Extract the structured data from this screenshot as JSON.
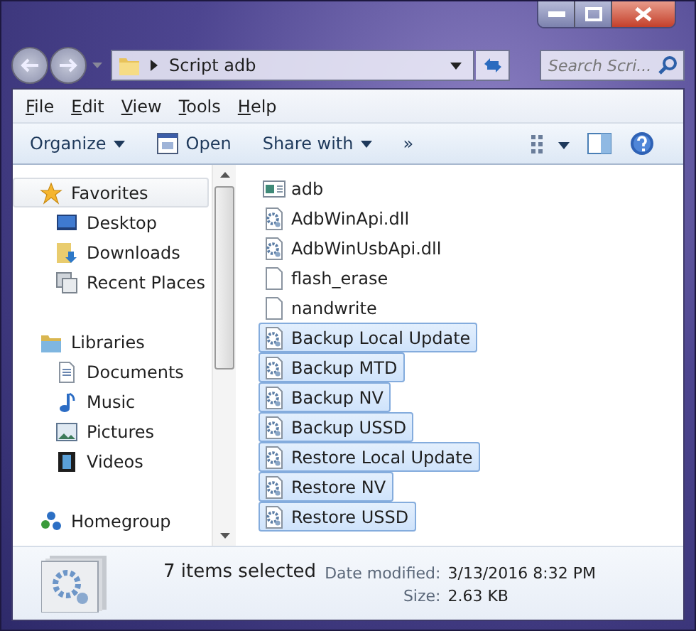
{
  "address": {
    "path": "Script adb"
  },
  "search": {
    "placeholder": "Search Scri..."
  },
  "menu": [
    "File",
    "Edit",
    "View",
    "Tools",
    "Help"
  ],
  "toolbar": [
    {
      "kind": "dropdown",
      "label": "Organize"
    },
    {
      "kind": "open",
      "label": "Open"
    },
    {
      "kind": "dropdown",
      "label": "Share with"
    },
    {
      "kind": "more",
      "label": "»"
    }
  ],
  "sidebar": {
    "groups": [
      {
        "label": "Favorites",
        "selected": true,
        "children": [
          {
            "label": "Desktop",
            "selected": false
          },
          {
            "label": "Downloads",
            "selected": false
          },
          {
            "label": "Recent Places",
            "selected": false
          }
        ]
      },
      {
        "label": "Libraries",
        "selected": false,
        "children": [
          {
            "label": "Documents",
            "selected": false
          },
          {
            "label": "Music",
            "selected": false
          },
          {
            "label": "Pictures",
            "selected": false
          },
          {
            "label": "Videos",
            "selected": false
          }
        ]
      },
      {
        "label": "Homegroup",
        "selected": false
      }
    ]
  },
  "files": [
    {
      "name": "adb",
      "kind": "application",
      "selected": false
    },
    {
      "name": "AdbWinApi.dll",
      "kind": "dll",
      "selected": false
    },
    {
      "name": "AdbWinUsbApi.dll",
      "kind": "dll",
      "selected": false
    },
    {
      "name": "flash_erase",
      "kind": "file",
      "selected": false
    },
    {
      "name": "nandwrite",
      "kind": "file",
      "selected": false
    },
    {
      "name": "Backup Local Update",
      "kind": "batch",
      "selected": true
    },
    {
      "name": "Backup MTD",
      "kind": "batch",
      "selected": true
    },
    {
      "name": "Backup NV",
      "kind": "batch",
      "selected": true
    },
    {
      "name": "Backup USSD",
      "kind": "batch",
      "selected": true
    },
    {
      "name": "Restore Local Update",
      "kind": "batch",
      "selected": true
    },
    {
      "name": "Restore NV",
      "kind": "batch",
      "selected": true
    },
    {
      "name": "Restore USSD",
      "kind": "batch",
      "selected": true
    }
  ],
  "details": {
    "summary": "7 items selected",
    "fields": [
      {
        "label": "Date modified:",
        "value": "3/13/2016 8:32 PM"
      },
      {
        "label": "Size:",
        "value": "2.63 KB"
      }
    ]
  }
}
